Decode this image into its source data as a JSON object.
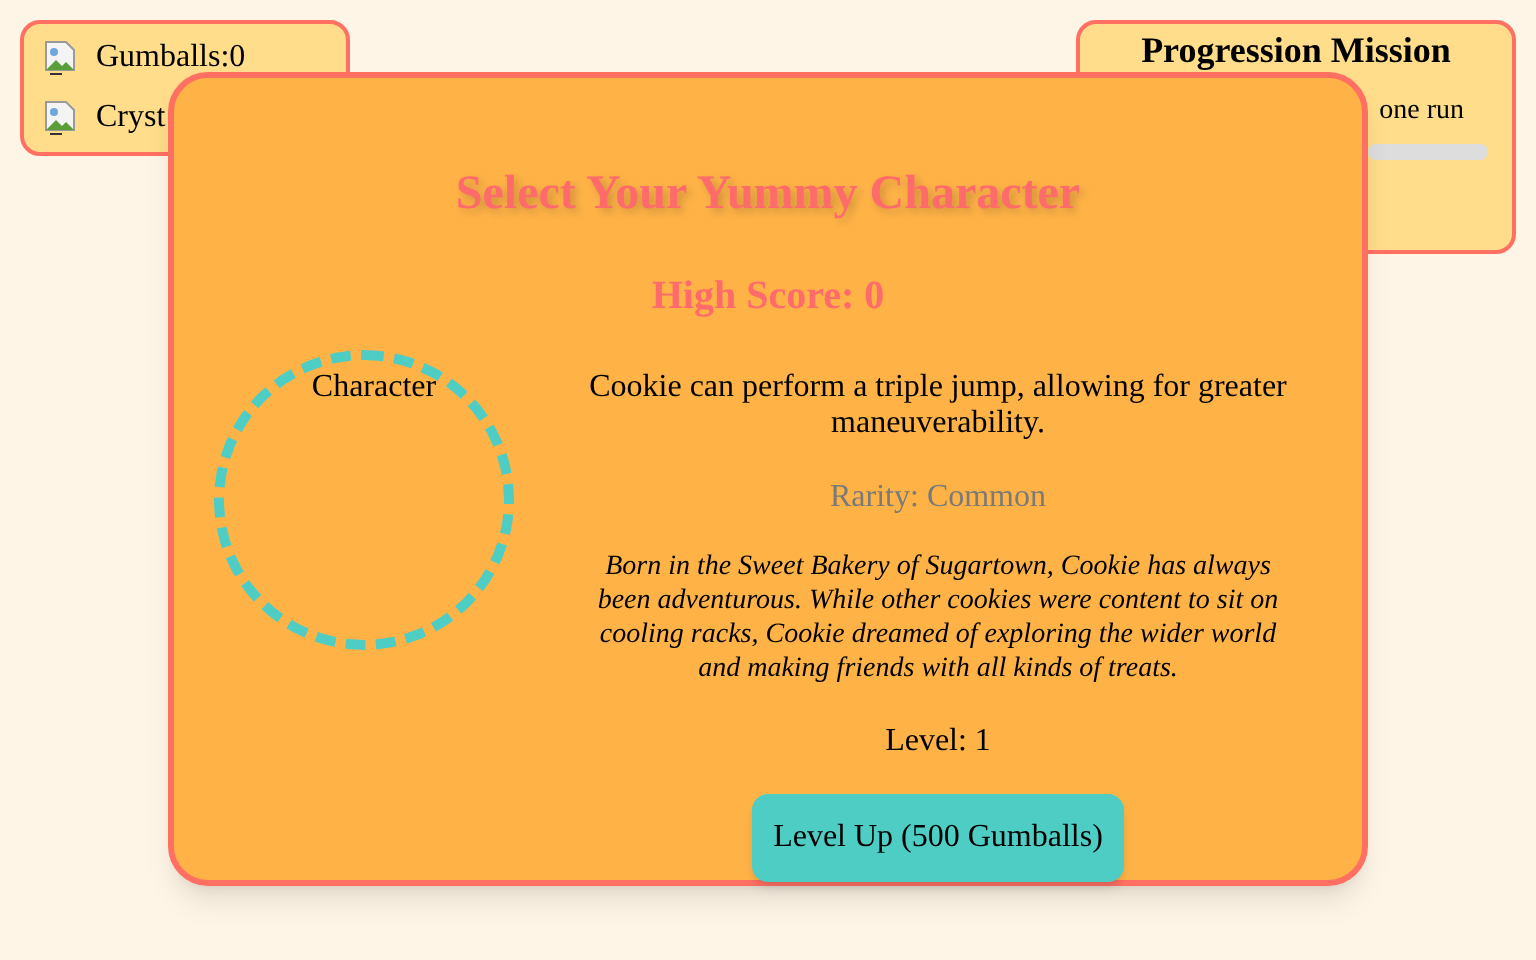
{
  "stats": [
    {
      "label": "Gumballs:",
      "value": "0"
    },
    {
      "label": "Cryst"
    }
  ],
  "mission": {
    "title": "Progression Mission",
    "description": "one run",
    "level": 0
  },
  "modal": {
    "title": "Select Your Yummy Character",
    "high_score": "High Score: 0",
    "character_alt": "Character",
    "ability": "Cookie can perform a triple jump, allowing for greater maneuverability.",
    "rarity": "Rarity: Common",
    "story": "Born in the Sweet Bakery of Sugartown, Cookie has always been adventurous. While other cookies were content to sit on cooling racks, Cookie dreamed of exploring the wider world and making friends with all kinds of treats.",
    "level": "Level: 1",
    "level_up_button": "Level Up (500 Gumballs)"
  }
}
